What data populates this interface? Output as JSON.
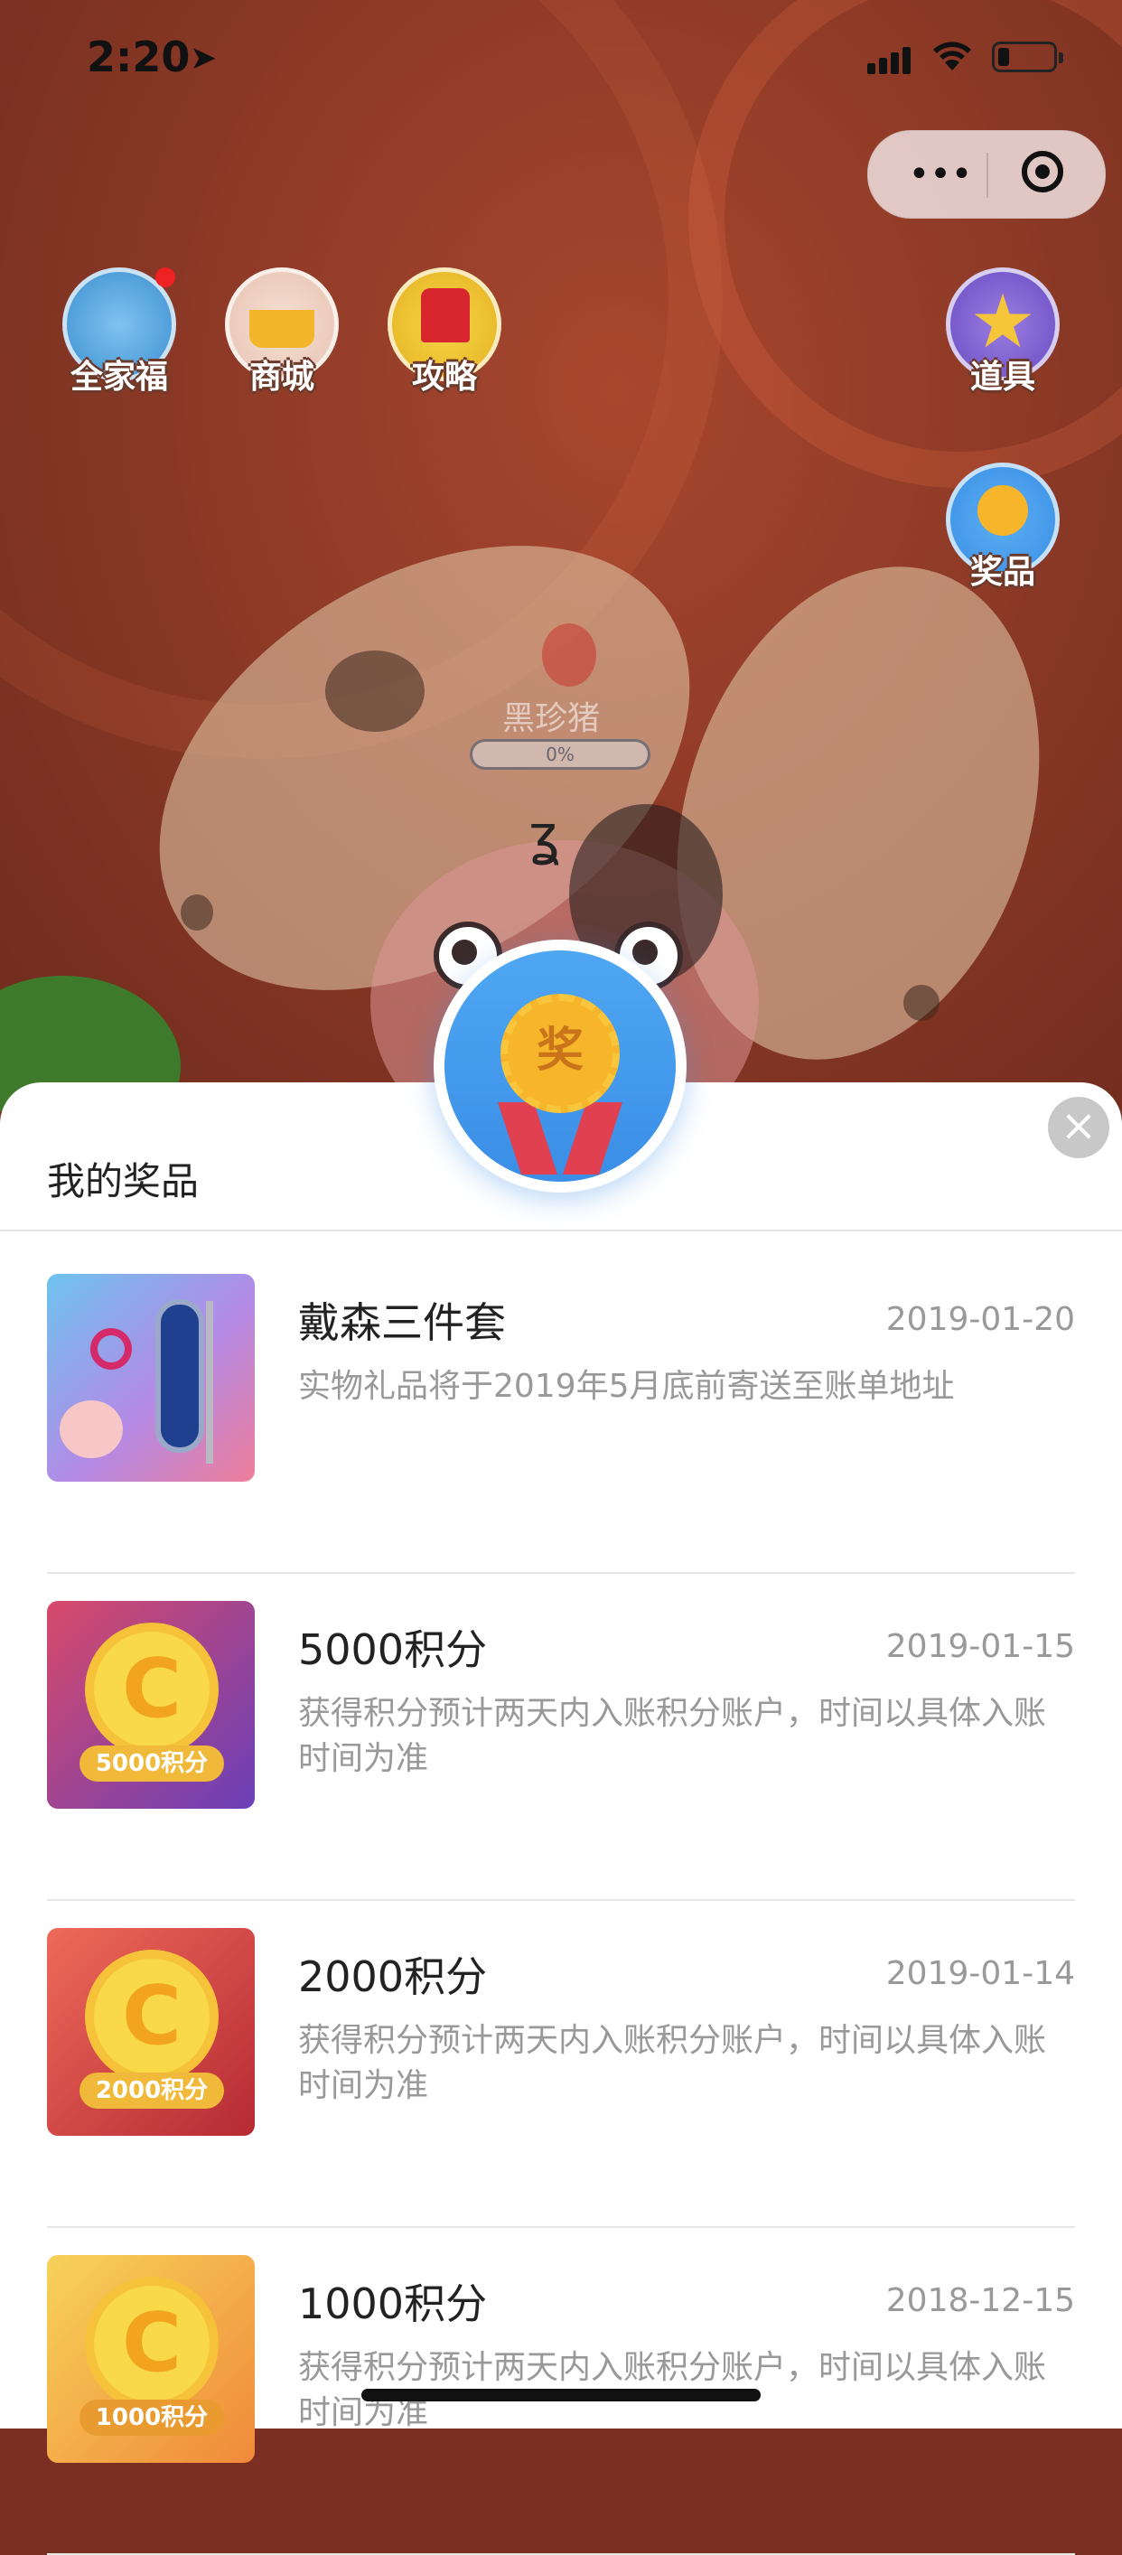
{
  "status_bar": {
    "time": "2:20",
    "location_icon": "location-arrow-icon",
    "signal_icon": "cellular-signal-icon",
    "wifi_icon": "wifi-icon",
    "battery_icon": "battery-icon",
    "battery_level": 0.2
  },
  "capsule": {
    "more_icon": "more-dots-icon",
    "more_label": "•••",
    "close_icon": "target-icon"
  },
  "game_icons": [
    {
      "label": "全家福",
      "icon": "family-photo-icon",
      "has_badge": true
    },
    {
      "label": "商城",
      "icon": "basket-icon",
      "has_badge": false
    },
    {
      "label": "攻略",
      "icon": "guide-hat-icon",
      "has_badge": false
    },
    {
      "label": "道具",
      "icon": "star-icon",
      "has_badge": false
    },
    {
      "label": "奖品",
      "icon": "medal-icon",
      "has_badge": false
    }
  ],
  "pet": {
    "name": "黑珍猪",
    "progress_label": "0%",
    "progress": 0.0
  },
  "sheet": {
    "title": "我的奖品",
    "close_icon": "close-icon",
    "close_label": "×",
    "badge_icon": "prize-medal-icon",
    "badge_text": "奖",
    "colors": {
      "badge_blue": "#4fa7f2",
      "medal_gold": "#f6b52a",
      "ribbon_red": "#e04050"
    }
  },
  "prizes": [
    {
      "name": "戴森三件套",
      "date": "2019-01-20",
      "desc": "实物礼品将于2019年5月底前寄送至账单地址",
      "thumb": "dyson-set-thumbnail",
      "thumb_tag": ""
    },
    {
      "name": "5000积分",
      "date": "2019-01-15",
      "desc": "获得积分预计两天内入账积分账户，时间以具体入账时间为准",
      "thumb": "points-coin-purple",
      "thumb_tag": "5000积分"
    },
    {
      "name": "2000积分",
      "date": "2019-01-14",
      "desc": "获得积分预计两天内入账积分账户，时间以具体入账时间为准",
      "thumb": "points-coin-red",
      "thumb_tag": "2000积分"
    },
    {
      "name": "1000积分",
      "date": "2018-12-15",
      "desc": "获得积分预计两天内入账积分账户，时间以具体入账时间为准",
      "thumb": "points-coin-orange",
      "thumb_tag": "1000积分"
    }
  ]
}
